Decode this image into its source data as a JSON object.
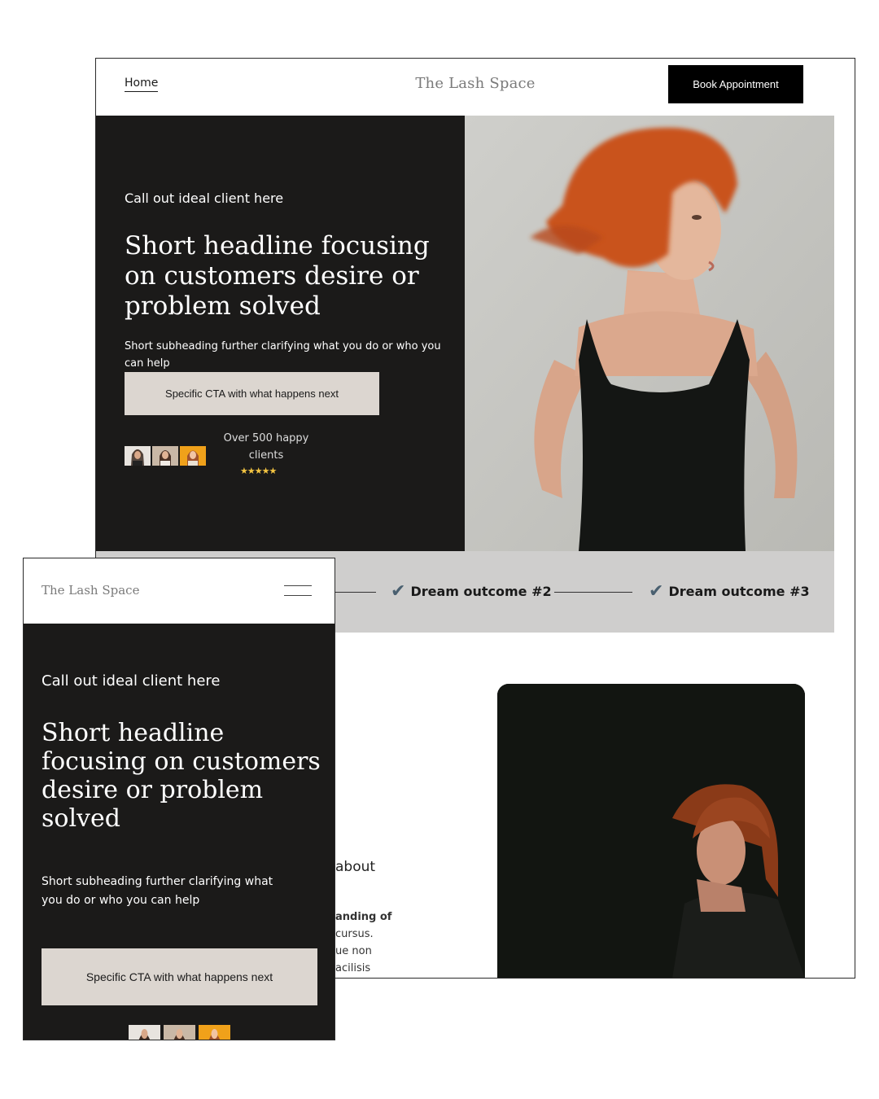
{
  "desktop": {
    "nav": {
      "home_label": "Home",
      "logo_text": "The Lash Space",
      "cta_label": "Book Appointment"
    },
    "hero": {
      "eyebrow": "Call out ideal client here",
      "headline": "Short headline focusing on customers desire or problem solved",
      "subheading": "Short subheading further clarifying what you do or who you can help",
      "cta_label": "Specific CTA with what happens next",
      "social_proof": "Over 500 happy clients",
      "rating_stars": "★★★★★"
    },
    "outcomes": [
      {
        "check": "✔",
        "label": "Dream outcome #2"
      },
      {
        "check": "✔",
        "label": "Dream outcome #3"
      }
    ],
    "about": {
      "title_fragment": "about",
      "body_lines": [
        "anding of",
        "cursus.",
        "ue non",
        "acilisis"
      ]
    }
  },
  "mobile": {
    "nav": {
      "logo_text": "The Lash Space",
      "menu_icon": "hamburger-icon"
    },
    "hero": {
      "eyebrow": "Call out ideal client here",
      "headline": "Short headline focusing on customers desire or problem solved",
      "subheading": "Short subheading further clarifying what you do or who you can help",
      "cta_label": "Specific CTA with what happens next"
    }
  },
  "colors": {
    "hero_bg": "#1b1a19",
    "cta_bg": "#dcd6d0",
    "nav_cta_bg": "#000000",
    "outcome_bar_bg": "#cfcecd",
    "check_color": "#4a6070",
    "star_color": "#f4c542"
  }
}
